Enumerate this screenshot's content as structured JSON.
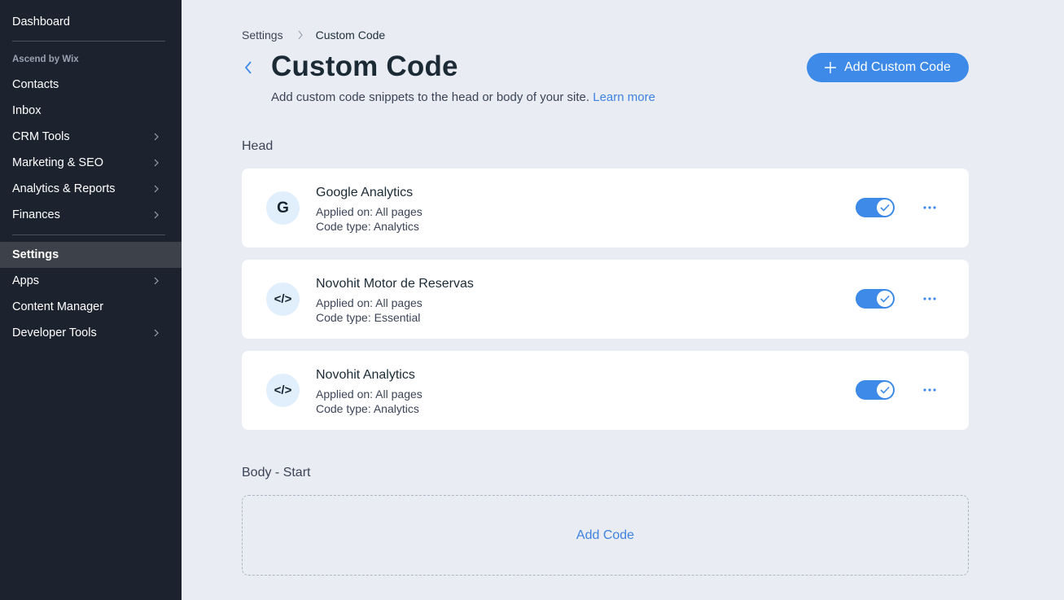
{
  "sidebar": {
    "top_item": "Dashboard",
    "section_label": "Ascend by Wix",
    "group1": [
      {
        "label": "Contacts"
      },
      {
        "label": "Inbox"
      },
      {
        "label": "CRM Tools"
      },
      {
        "label": "Marketing & SEO"
      },
      {
        "label": "Analytics & Reports"
      },
      {
        "label": "Finances"
      }
    ],
    "group2": [
      {
        "label": "Settings"
      },
      {
        "label": "Apps"
      },
      {
        "label": "Content Manager"
      },
      {
        "label": "Developer Tools"
      }
    ]
  },
  "breadcrumb": {
    "parent": "Settings",
    "current": "Custom Code"
  },
  "header": {
    "title": "Custom Code",
    "subtitle": "Add custom code snippets to the head or body of your site.",
    "learn_more": "Learn more",
    "add_button": "Add Custom Code"
  },
  "head_section": {
    "title": "Head",
    "items": [
      {
        "icon": "G",
        "name": "Google Analytics",
        "applied": "Applied on: All pages",
        "type": "Code type: Analytics",
        "enabled": true
      },
      {
        "icon": "</>",
        "name": "Novohit Motor de Reservas",
        "applied": "Applied on: All pages",
        "type": "Code type: Essential",
        "enabled": true
      },
      {
        "icon": "</>",
        "name": "Novohit Analytics",
        "applied": "Applied on: All pages",
        "type": "Code type: Analytics",
        "enabled": true
      }
    ]
  },
  "body_start": {
    "title": "Body - Start",
    "add_code": "Add Code"
  },
  "colors": {
    "accent": "#3d8ae8",
    "sidebar": "#1c222e",
    "background": "#e9ecf2"
  }
}
